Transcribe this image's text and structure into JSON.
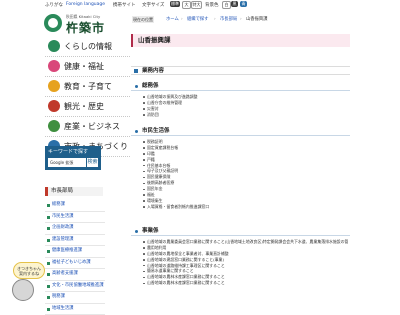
{
  "header": {
    "links": [
      {
        "label": "ふりがな",
        "style": "normal"
      },
      {
        "label": "Foreign language",
        "style": "blue"
      },
      {
        "label": "携帯サイト",
        "style": "normal"
      },
      {
        "label": "文字サイズ",
        "style": "normal"
      }
    ],
    "font_size_buttons": [
      "標準",
      "大",
      "特大"
    ],
    "bg_label": "背景色",
    "bg_buttons": [
      "白",
      "黒",
      "青"
    ],
    "logo_sub": "秋田県  Kitaaki City",
    "logo_name": "杵築市"
  },
  "sidenav": {
    "items": [
      {
        "label": "くらしの情報",
        "color": "#2a8a5a"
      },
      {
        "label": "健康・福祉",
        "color": "#d9477a"
      },
      {
        "label": "教育・子育て",
        "color": "#e6a21f"
      },
      {
        "label": "観光・歴史",
        "color": "#c0392b"
      },
      {
        "label": "産業・ビジネス",
        "color": "#3f8f3f"
      },
      {
        "label": "市政・まちづくり",
        "color": "#2a6fa8"
      }
    ]
  },
  "search": {
    "title": "キーワードで探す",
    "field_label": "Google 拡張",
    "button": "検索"
  },
  "section_nav": {
    "heading": "市長部局",
    "items": [
      "総務課",
      "市民生活課",
      "企画財政課",
      "建設管理課",
      "健康医療推進課",
      "福祉子どもいじめ課",
      "高齢者支援課",
      "文化・市民協働地域推進課",
      "税務課",
      "地域生活課"
    ]
  },
  "mascot": {
    "bubble": "きつきちゃん\n案内するね"
  },
  "breadcrumb": {
    "here": "現在の位置",
    "items": [
      "ホーム",
      "組織で探す",
      "市長部局"
    ],
    "current": "山香振興課"
  },
  "page_title": "山香振興課",
  "content": {
    "heading": "業務内容",
    "sections": [
      {
        "title": "総務係",
        "items": [
          "山香地域の振興及び進路調整",
          "山香庁舎の維持管理",
          "災害対",
          "消防団"
        ]
      },
      {
        "title": "市民生活係",
        "items": [
          "税務証明",
          "固定資産課税台帳",
          "印鑑",
          "戸籍",
          "住民基本台帳",
          "母子及び父親証明",
          "国民健康保険",
          "後期高齢者医療",
          "国民年金",
          "福祉",
          "環境衛生",
          "入場資格・留食者別帳内推進課窓口"
        ]
      },
      {
        "title": "事業係",
        "items": [
          "山香地域の農業委員会窓口業務に関すること(山香地域土地改良区)特定開発課会会共下水道、農業集落排水施設の管理",
          "#cont:農業集落排水施設の管理",
          "農用地利用",
          "山香地域の農地保全と事業者対、事業直計補整",
          "山香地域の建設窓口業務に関すること(事業)",
          "山香地域の道路維持課工事理区に関すること",
          "簡易水道事業に関すること",
          "山香地域の農林水産課窓口業務に関すること",
          "山香地域の農林水産課窓口業務に関すること"
        ]
      }
    ]
  }
}
